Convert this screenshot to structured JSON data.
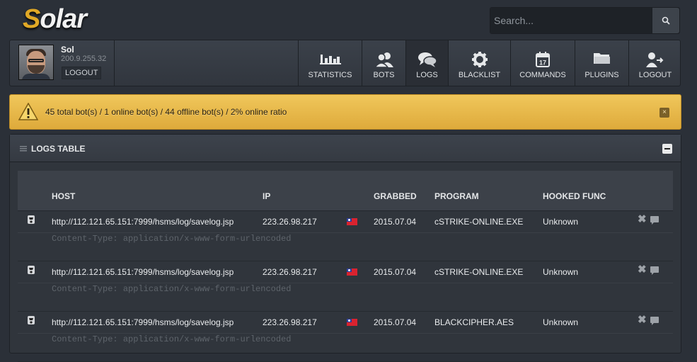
{
  "app": {
    "logo_first": "S",
    "logo_rest": "olar"
  },
  "search": {
    "placeholder": "Search..."
  },
  "user": {
    "name": "Sol",
    "ip": "200.9.255.32",
    "logout_label": "LOGOUT"
  },
  "nav": [
    {
      "label": "STATISTICS",
      "icon": "bar-chart-icon"
    },
    {
      "label": "BOTS",
      "icon": "users-icon"
    },
    {
      "label": "LOGS",
      "icon": "chat-bubbles-icon",
      "active": true
    },
    {
      "label": "BLACKLIST",
      "icon": "gear-icon"
    },
    {
      "label": "COMMANDS",
      "icon": "calendar-icon",
      "calendar_day": "17"
    },
    {
      "label": "PLUGINS",
      "icon": "folder-icon"
    },
    {
      "label": "LOGOUT",
      "icon": "user-logout-icon"
    }
  ],
  "alert": {
    "text": "45 total bot(s) / 1 online bot(s) / 44 offline bot(s) / 2% online ratio",
    "close": "×"
  },
  "panel": {
    "title": "LOGS TABLE"
  },
  "table": {
    "headers": {
      "host": "HOST",
      "ip": "IP",
      "grabbed": "GRABBED",
      "program": "PROGRAM",
      "hooked": "HOOKED FUNC"
    },
    "rows": [
      {
        "host": "http://112.121.65.151:7999/hsms/log/savelog.jsp",
        "ip": "223.26.98.217",
        "grabbed": "2015.07.04",
        "program": "cSTRIKE-ONLINE.EXE",
        "hooked": "Unknown",
        "content_type": "Content-Type: application/x-www-form-urlencoded"
      },
      {
        "host": "http://112.121.65.151:7999/hsms/log/savelog.jsp",
        "ip": "223.26.98.217",
        "grabbed": "2015.07.04",
        "program": "cSTRIKE-ONLINE.EXE",
        "hooked": "Unknown",
        "content_type": "Content-Type: application/x-www-form-urlencoded"
      },
      {
        "host": "http://112.121.65.151:7999/hsms/log/savelog.jsp",
        "ip": "223.26.98.217",
        "grabbed": "2015.07.04",
        "program": "BLACKCIPHER.AES",
        "hooked": "Unknown",
        "content_type": "Content-Type: application/x-www-form-urlencoded"
      }
    ]
  },
  "colors": {
    "accent": "#e0a826",
    "alert_bg": "#f0c75b",
    "page_bg": "#2b3038"
  }
}
